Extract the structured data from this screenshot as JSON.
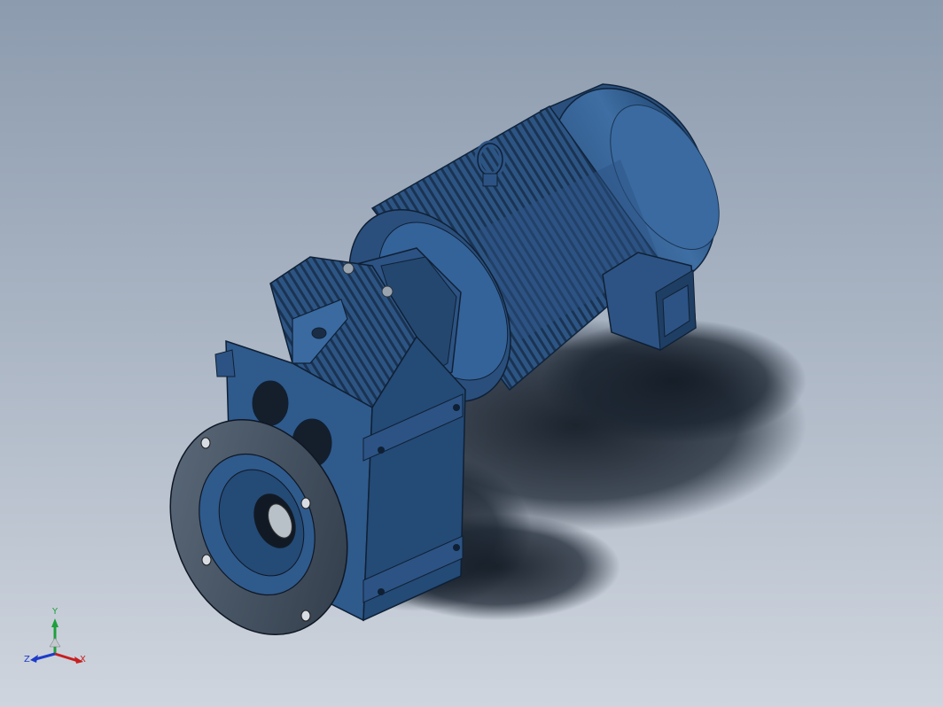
{
  "scene": {
    "background_top": "#8c9bae",
    "background_bottom": "#cfd5de",
    "model_color": "#2f5a8c",
    "model_shadow_color": "#17222f",
    "flange_color": "#3e4b5a"
  },
  "triad": {
    "x_label": "X",
    "y_label": "Y",
    "z_label": "Z",
    "x_color": "#c81e1e",
    "y_color": "#1ea03c",
    "z_color": "#1e3cc8"
  }
}
